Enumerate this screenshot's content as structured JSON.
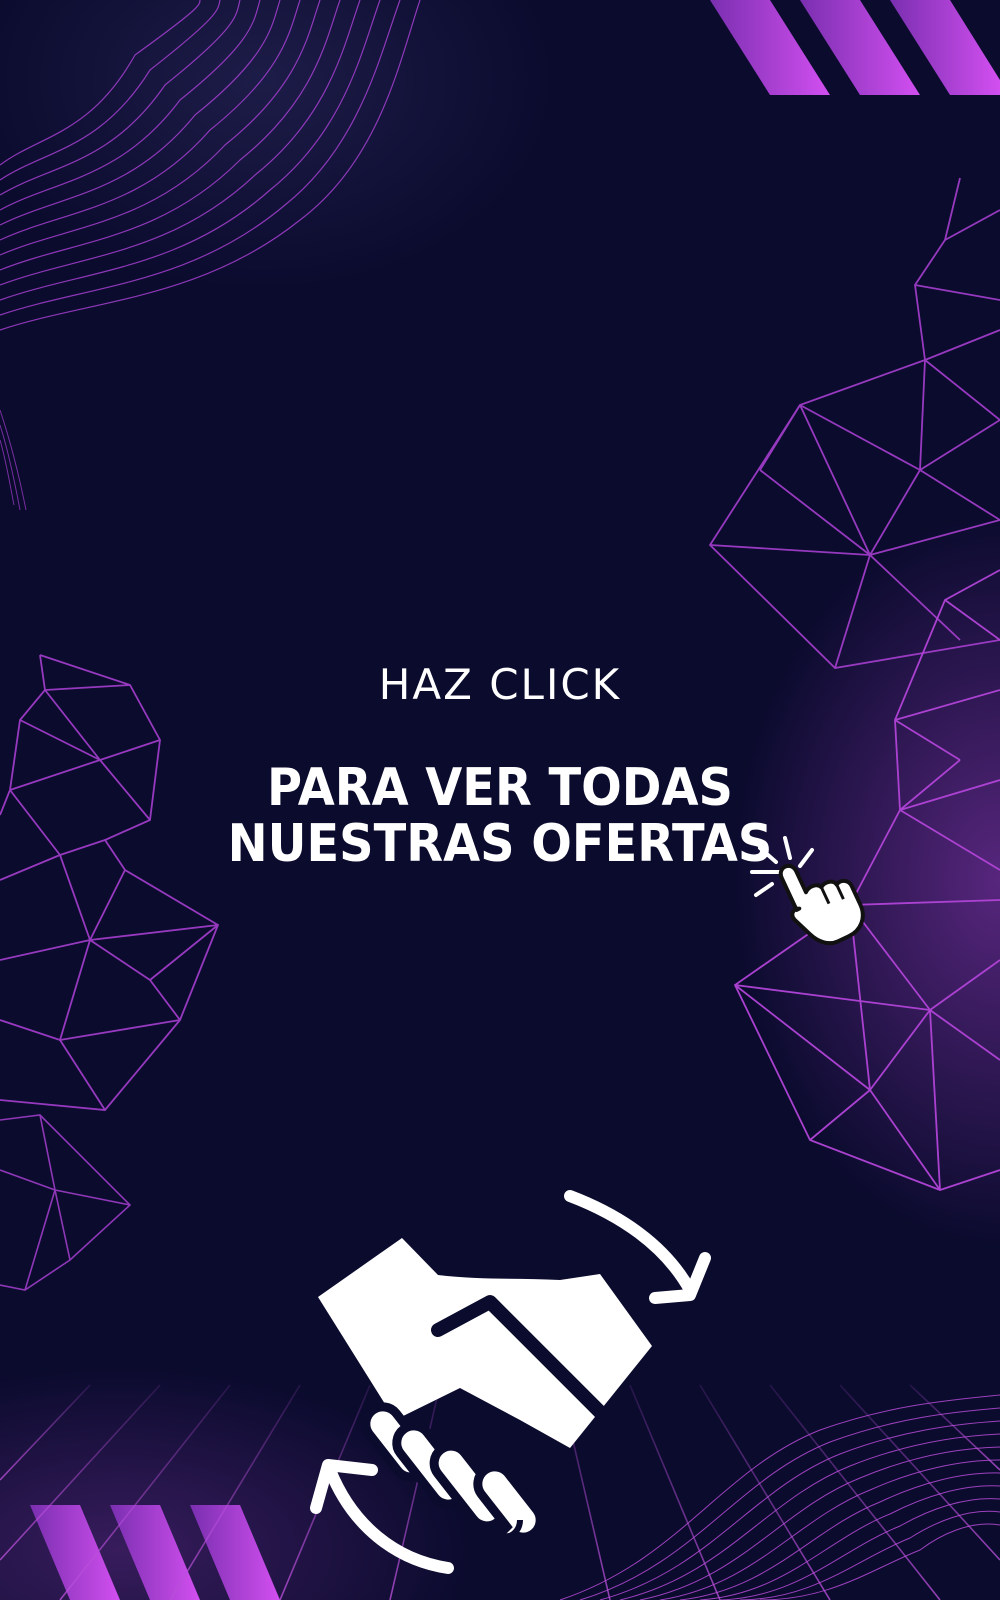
{
  "promo": {
    "headline": "HAZ CLICK",
    "subline_1": "PARA VER TODAS",
    "subline_2": "NUESTRAS OFERTAS"
  },
  "icons": {
    "pointer": "pointing-hand-click-icon",
    "deal": "handshake-exchange-icon"
  },
  "colors": {
    "background": "#0b0b2e",
    "accent": "#b84fd9",
    "text": "#ffffff"
  }
}
